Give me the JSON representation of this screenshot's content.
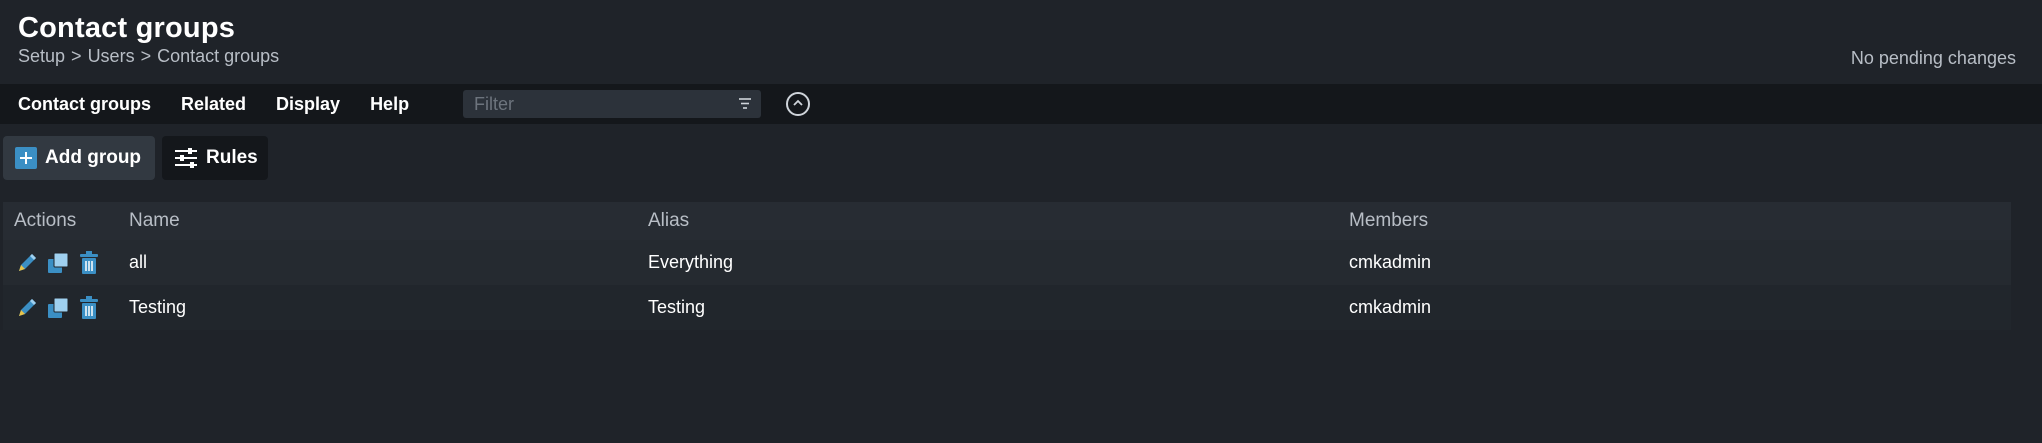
{
  "header": {
    "title": "Contact groups",
    "breadcrumb": [
      "Setup",
      ">",
      "Users",
      ">",
      "Contact groups"
    ],
    "pending": "No pending changes"
  },
  "menu": {
    "items": [
      "Contact groups",
      "Related",
      "Display",
      "Help"
    ],
    "filter_placeholder": "Filter",
    "filter_value": ""
  },
  "toolbar": {
    "add_label": "Add group",
    "rules_label": "Rules"
  },
  "table": {
    "headers": {
      "actions": "Actions",
      "name": "Name",
      "alias": "Alias",
      "members": "Members"
    },
    "rows": [
      {
        "name": "all",
        "alias": "Everything",
        "members": "cmkadmin"
      },
      {
        "name": "Testing",
        "alias": "Testing",
        "members": "cmkadmin"
      }
    ]
  },
  "icons": {
    "edit": "pencil-icon",
    "clone": "clone-icon",
    "delete": "trash-icon",
    "add": "plus-icon",
    "rules": "rules-icon",
    "filter": "filter-icon",
    "collapse": "chevron-up-icon"
  },
  "colors": {
    "accent": "#3b8fc4",
    "background": "#1f2329",
    "menubar": "#14171b"
  }
}
